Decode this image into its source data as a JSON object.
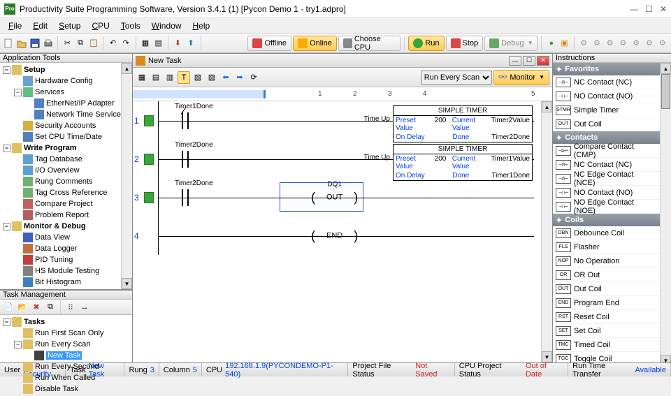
{
  "window": {
    "title": "Productivity Suite Programming Software, Version 3.4.1 (1)    [Pycon Demo 1 - try1.adpro]",
    "logo_text": "Pro"
  },
  "menu": [
    "File",
    "Edit",
    "Setup",
    "CPU",
    "Tools",
    "Window",
    "Help"
  ],
  "toolbar": {
    "offline": "Offline",
    "online": "Online",
    "choose_cpu": "Choose CPU",
    "run": "Run",
    "stop": "Stop",
    "debug": "Debug"
  },
  "left_panel_title": "Application Tools",
  "app_tree": [
    {
      "d": 0,
      "exp": "-",
      "bold": true,
      "ico": "#e0c060",
      "label": "Setup"
    },
    {
      "d": 1,
      "exp": "",
      "ico": "#6aa0d0",
      "label": "Hardware Config"
    },
    {
      "d": 1,
      "exp": "-",
      "ico": "#60c080",
      "label": "Services"
    },
    {
      "d": 2,
      "exp": "",
      "ico": "#5080c0",
      "label": "EtherNet/IP Adapter"
    },
    {
      "d": 2,
      "exp": "",
      "ico": "#5080c0",
      "label": "Network Time Service"
    },
    {
      "d": 1,
      "exp": "",
      "ico": "#d0b040",
      "label": "Security Accounts"
    },
    {
      "d": 1,
      "exp": "",
      "ico": "#5080c0",
      "label": "Set CPU Time/Date"
    },
    {
      "d": 0,
      "exp": "-",
      "bold": true,
      "ico": "#e0c060",
      "label": "Write Program"
    },
    {
      "d": 1,
      "exp": "",
      "ico": "#60a0d0",
      "label": "Tag Database"
    },
    {
      "d": 1,
      "exp": "",
      "ico": "#60a0d0",
      "label": "I/O Overview"
    },
    {
      "d": 1,
      "exp": "",
      "ico": "#70b070",
      "label": "Rung Comments"
    },
    {
      "d": 1,
      "exp": "",
      "ico": "#70b070",
      "label": "Tag Cross Reference"
    },
    {
      "d": 1,
      "exp": "",
      "ico": "#c06060",
      "label": "Compare Project"
    },
    {
      "d": 1,
      "exp": "",
      "ico": "#b06060",
      "label": "Problem Report"
    },
    {
      "d": 0,
      "exp": "-",
      "bold": true,
      "ico": "#e0c060",
      "label": "Monitor & Debug"
    },
    {
      "d": 1,
      "exp": "",
      "ico": "#4060c0",
      "label": "Data View"
    },
    {
      "d": 1,
      "exp": "",
      "ico": "#c07040",
      "label": "Data Logger"
    },
    {
      "d": 1,
      "exp": "",
      "ico": "#c04040",
      "label": "PID Tuning"
    },
    {
      "d": 1,
      "exp": "",
      "ico": "#808080",
      "label": "HS Module Testing"
    },
    {
      "d": 1,
      "exp": "",
      "ico": "#4080c0",
      "label": "Bit Histogram"
    }
  ],
  "task_panel_title": "Task Management",
  "task_tree": [
    {
      "d": 0,
      "exp": "-",
      "bold": true,
      "ico": "#e0c060",
      "label": "Tasks"
    },
    {
      "d": 1,
      "exp": "",
      "ico": "#e0c060",
      "label": "Run First Scan Only"
    },
    {
      "d": 1,
      "exp": "-",
      "ico": "#e0c060",
      "label": "Run Every Scan"
    },
    {
      "d": 2,
      "exp": "",
      "ico": "#404040",
      "label": "New Task",
      "sel": true
    },
    {
      "d": 1,
      "exp": "",
      "ico": "#e0c060",
      "label": "Run Every Second"
    },
    {
      "d": 1,
      "exp": "",
      "ico": "#e0c060",
      "label": "Run When Called"
    },
    {
      "d": 1,
      "exp": "",
      "ico": "#e0c060",
      "label": "Disable Task"
    }
  ],
  "doc": {
    "title": "New Task",
    "scan_mode": "Run Every Scan",
    "monitor_btn": "Monitor",
    "ruler": [
      "1",
      "2",
      "3",
      "4",
      "5"
    ]
  },
  "rungs": [
    {
      "n": "1",
      "contact": {
        "label": "Timer1Done",
        "nc": true
      },
      "right_label": "Time Up",
      "timer": {
        "title": "SIMPLE TIMER",
        "rows": [
          [
            "Preset Value",
            "200",
            "Current Value",
            "Timer2Value"
          ],
          [
            "On Delay",
            "",
            "Done",
            "Timer2Done"
          ]
        ]
      }
    },
    {
      "n": "2",
      "contact": {
        "label": "Timer2Done",
        "nc": false
      },
      "right_label": "Time Up",
      "timer": {
        "title": "SIMPLE TIMER",
        "rows": [
          [
            "Preset Value",
            "200",
            "Current Value",
            "Timer1Value"
          ],
          [
            "On Delay",
            "",
            "Done",
            "Timer1Done"
          ]
        ]
      }
    },
    {
      "n": "3",
      "contact": {
        "label": "Timer2Done",
        "nc": false
      },
      "out": {
        "top": "DQ1",
        "text": "OUT"
      },
      "selected": true
    },
    {
      "n": "4",
      "out": {
        "text": "END"
      }
    }
  ],
  "instructions_title": "Instructions",
  "instr_groups": [
    {
      "title": "Favorites",
      "items": [
        [
          "⊣/⊢",
          "NC Contact  (NC)"
        ],
        [
          "⊣ ⊢",
          "NO Contact  (NO)"
        ],
        [
          "STMR",
          "Simple Timer"
        ],
        [
          "OUT",
          "Out Coil"
        ]
      ]
    },
    {
      "title": "Contacts",
      "items": [
        [
          "⊣≥⊢",
          "Compare Contact  (CMP)"
        ],
        [
          "⊣/⊢",
          "NC Contact  (NC)"
        ],
        [
          "⊣/⊢",
          "NC Edge Contact  (NCE)"
        ],
        [
          "⊣ ⊢",
          "NO Contact  (NO)"
        ],
        [
          "⊣ ⊢",
          "NO Edge Contact  (NOE)"
        ]
      ]
    },
    {
      "title": "Coils",
      "items": [
        [
          "DBN",
          "Debounce Coil"
        ],
        [
          "FLS",
          "Flasher"
        ],
        [
          "NOP",
          "No Operation"
        ],
        [
          "OR",
          "OR Out"
        ],
        [
          "OUT",
          "Out Coil"
        ],
        [
          "END",
          "Program End"
        ],
        [
          "RST",
          "Reset Coil"
        ],
        [
          "SET",
          "Set Coil"
        ],
        [
          "TMC",
          "Timed Coil"
        ],
        [
          "TGC",
          "Toggle Coil"
        ]
      ]
    }
  ],
  "status": {
    "user_lbl": "User",
    "user_val": "No Security",
    "task_lbl": "Task",
    "task_val": "New Task",
    "rung_lbl": "Rung",
    "rung_val": "3",
    "col_lbl": "Column",
    "col_val": "5",
    "cpu_lbl": "CPU",
    "cpu_val": "192.168.1.9(PYCONDEMO-P1-540)",
    "pfs_lbl": "Project File Status",
    "pfs_val": "Not Saved",
    "cps_lbl": "CPU Project Status",
    "cps_val": "Out of Date",
    "rtt_lbl": "Run Time Transfer",
    "rtt_val": "Available"
  }
}
